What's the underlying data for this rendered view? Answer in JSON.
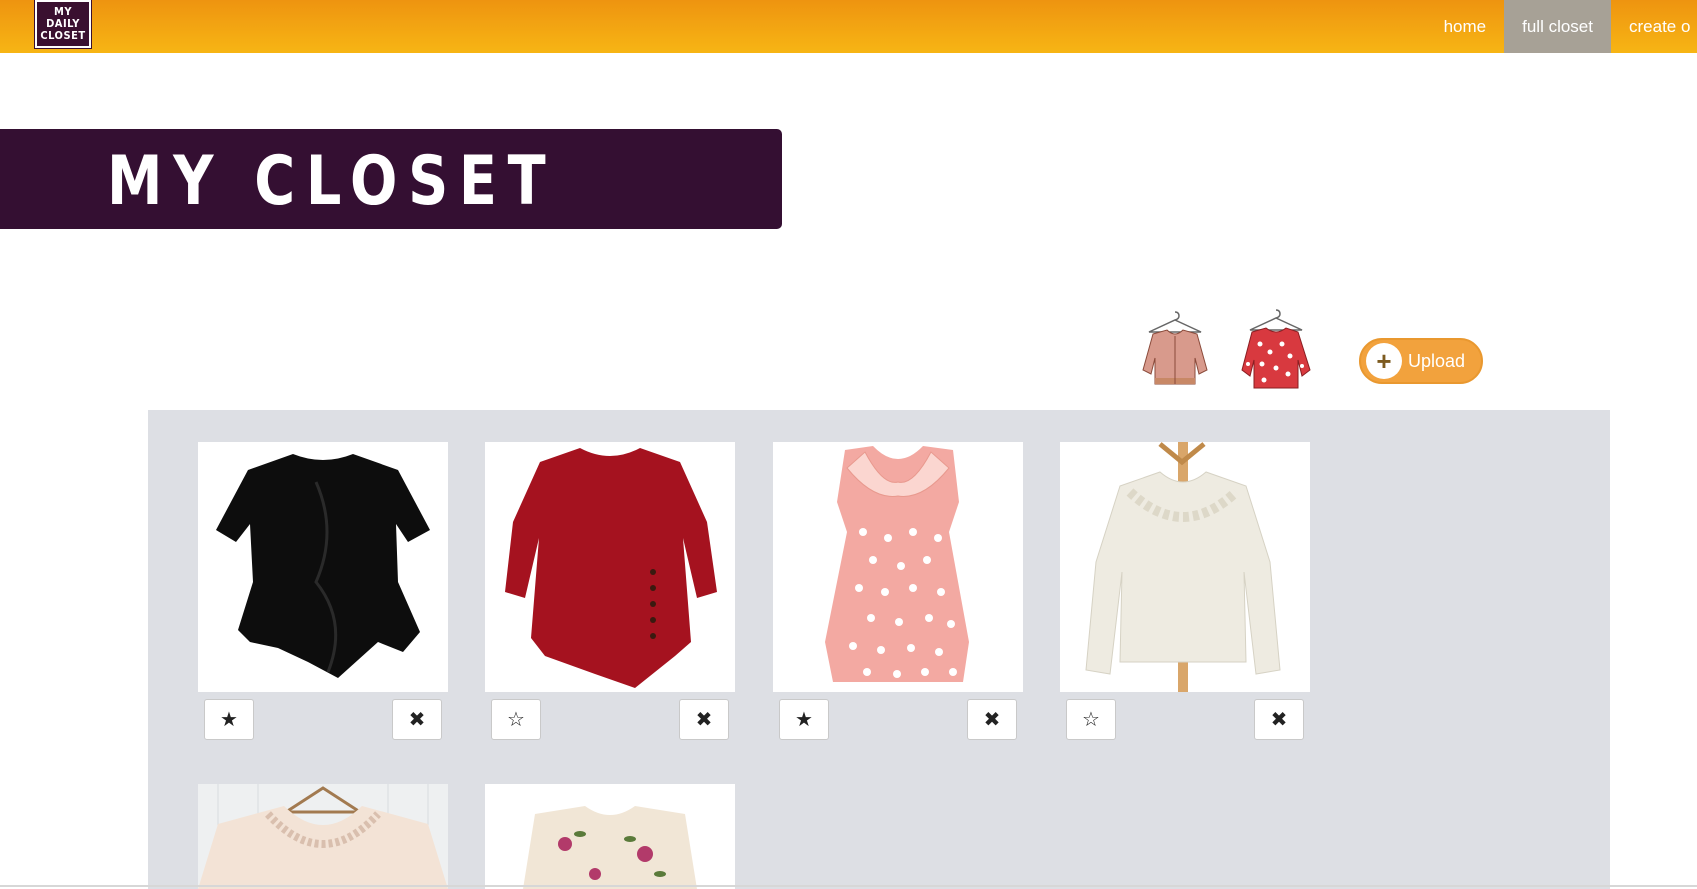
{
  "logo": {
    "line1": "MY",
    "line2": "DAILY",
    "line3": "CLOSET"
  },
  "nav": {
    "home": "home",
    "full_closet": "full closet",
    "create": "create o"
  },
  "banner": {
    "title": "MY CLOSET"
  },
  "upload": {
    "label": "Upload",
    "icon": "+"
  },
  "items": [
    {
      "star": "★",
      "remove": "✖",
      "favorited": true
    },
    {
      "star": "☆",
      "remove": "✖",
      "favorited": false
    },
    {
      "star": "★",
      "remove": "✖",
      "favorited": true
    },
    {
      "star": "☆",
      "remove": "✖",
      "favorited": false
    },
    {
      "star": "",
      "remove": "",
      "favorited": false
    },
    {
      "star": "",
      "remove": "",
      "favorited": false
    }
  ],
  "colors": {
    "nav_gradient_top": "#ee9410",
    "nav_gradient_bottom": "#f7b514",
    "nav_active": "#a7a196",
    "banner": "#340f32",
    "upload_button": "#f2a23d",
    "closet_background": "#dddfe4"
  }
}
